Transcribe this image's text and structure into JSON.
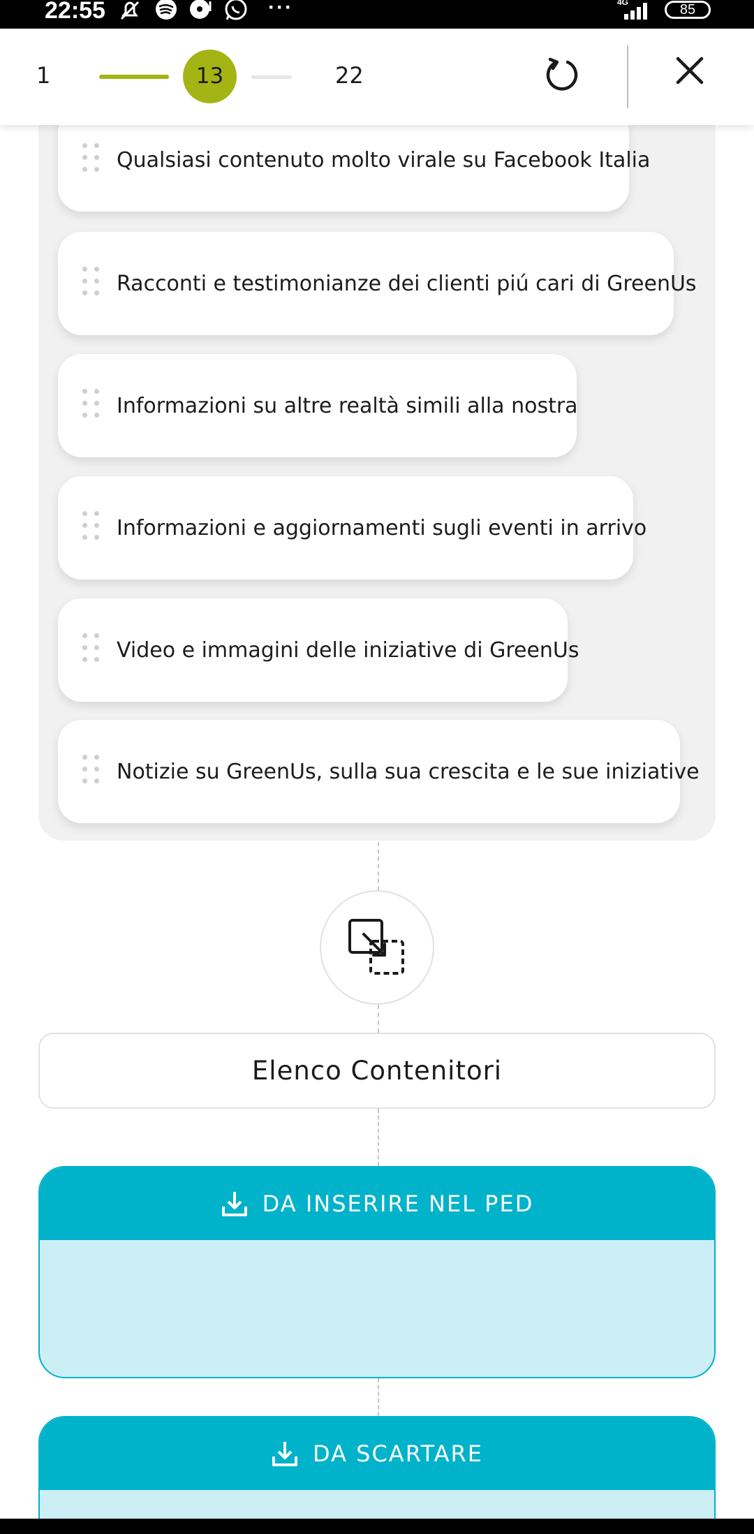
{
  "status_bar": {
    "time": "22:55",
    "network": "4G",
    "battery": "85",
    "icons": [
      "muted-notifications-icon",
      "spotify-icon",
      "music-icon",
      "whatsapp-icon",
      "more-dots-icon",
      "signal-icon",
      "battery-icon"
    ],
    "more": "···"
  },
  "progress": {
    "start": "1",
    "current": "13",
    "end": "22",
    "accent_color": "#a4b414"
  },
  "header": {
    "reset_icon": "refresh-icon",
    "close_icon": "close-icon"
  },
  "cards": [
    {
      "label": "Qualsiasi contenuto molto virale su Facebook Italia"
    },
    {
      "label": "Racconti e testimonianze dei clienti piú cari di GreenUs"
    },
    {
      "label": "Informazioni su altre realtà simili alla nostra"
    },
    {
      "label": "Informazioni e aggiornamenti sugli eventi in arrivo"
    },
    {
      "label": "Video e immagini delle iniziative di GreenUs"
    },
    {
      "label": "Notizie su GreenUs, sulla sua crescita e le sue iniziative"
    }
  ],
  "containers": {
    "title": "Elenco Contenitori",
    "move_icon": "move-to-container-icon",
    "bins": [
      {
        "label": "DA INSERIRE NEL PED",
        "icon": "download-icon"
      },
      {
        "label": "DA SCARTARE",
        "icon": "download-icon"
      }
    ],
    "bin_color": "#00b2ca",
    "bin_fill_color": "#cceef5"
  }
}
